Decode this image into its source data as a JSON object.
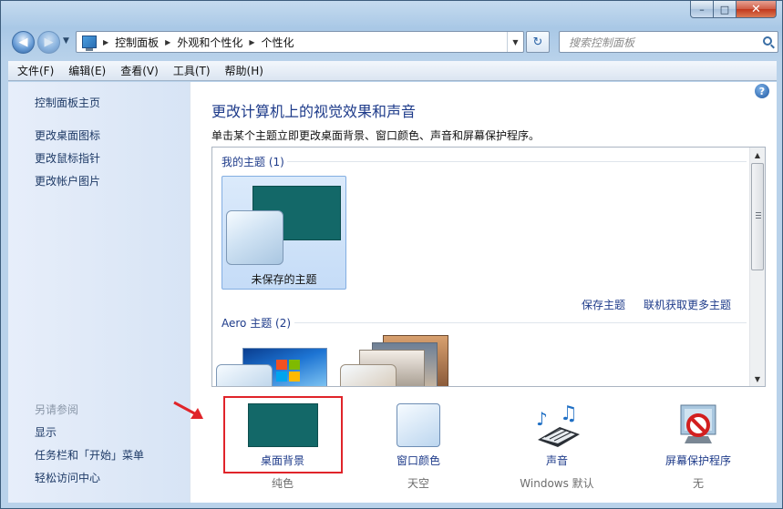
{
  "window": {
    "minimize": "–",
    "maximize": "□",
    "close": "✕"
  },
  "address": {
    "crumbs": [
      "控制面板",
      "外观和个性化",
      "个性化"
    ],
    "search_placeholder": "搜索控制面板"
  },
  "menu": [
    "文件(F)",
    "编辑(E)",
    "查看(V)",
    "工具(T)",
    "帮助(H)"
  ],
  "sidebar": {
    "home": "控制面板主页",
    "links": [
      "更改桌面图标",
      "更改鼠标指针",
      "更改帐户图片"
    ],
    "see_also_heading": "另请参阅",
    "see_also": [
      "显示",
      "任务栏和「开始」菜单",
      "轻松访问中心"
    ]
  },
  "main": {
    "title": "更改计算机上的视觉效果和声音",
    "description": "单击某个主题立即更改桌面背景、窗口颜色、声音和屏幕保护程序。"
  },
  "themes": {
    "my_group": "我的主题 (1)",
    "unsaved_theme": "未保存的主题",
    "save_link": "保存主题",
    "online_link": "联机获取更多主题",
    "aero_group": "Aero 主题 (2)"
  },
  "settings": [
    {
      "label": "桌面背景",
      "value": "纯色"
    },
    {
      "label": "窗口颜色",
      "value": "天空"
    },
    {
      "label": "声音",
      "value": "Windows 默认"
    },
    {
      "label": "屏幕保护程序",
      "value": "无"
    }
  ],
  "colors": {
    "desktop_bg": "#136868",
    "link": "#1e3b8a",
    "highlight": "#e0242a"
  }
}
